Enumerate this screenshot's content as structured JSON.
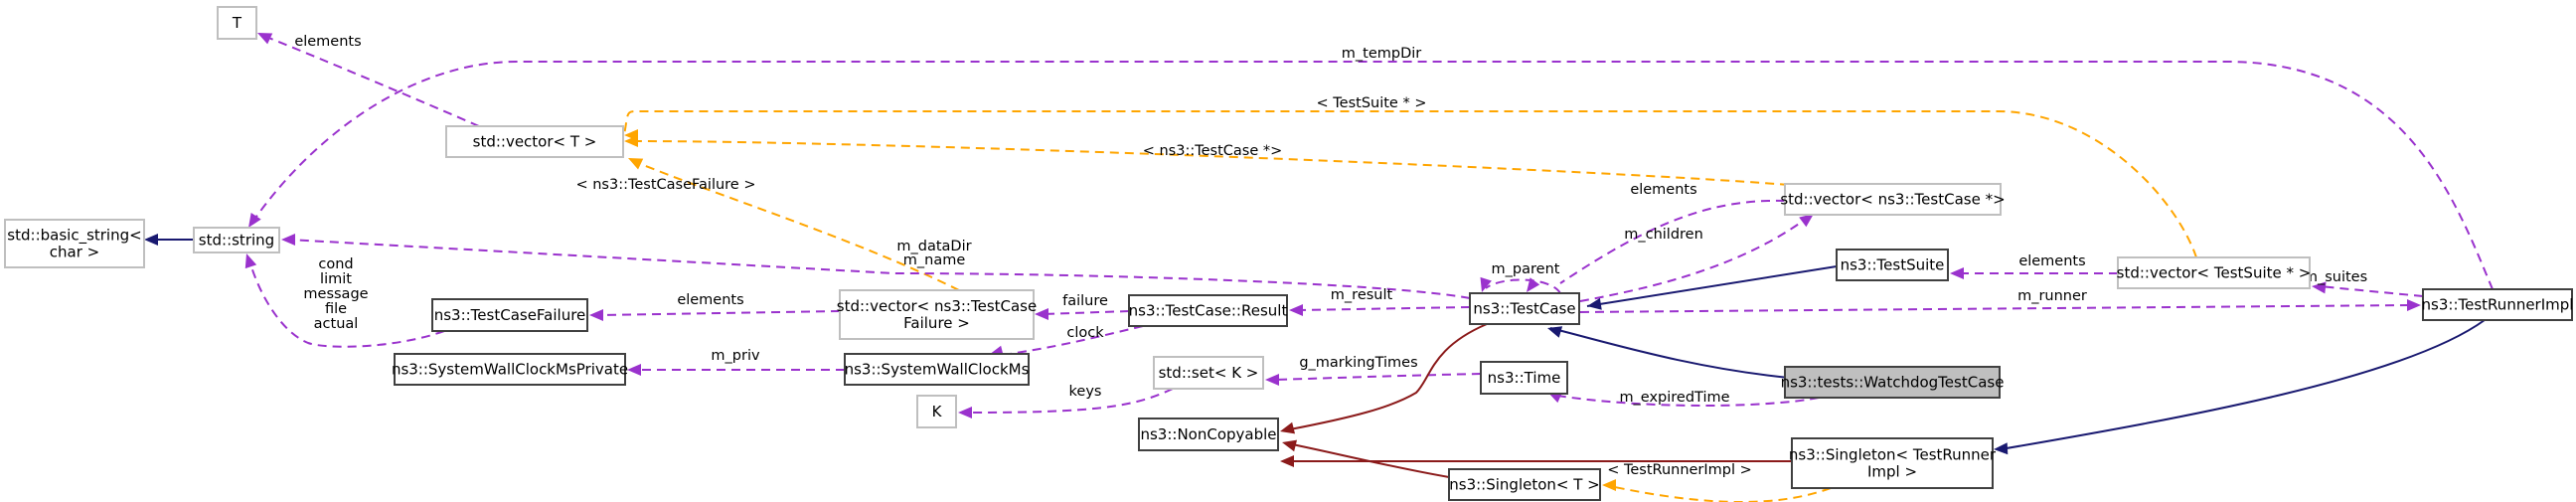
{
  "diagram": {
    "type": "doxygen-collaboration-graph",
    "focus_node": "ns3::tests::WatchdogTestCase",
    "colors": {
      "inheritance": "#191970",
      "usage": "#9a32cd",
      "template": "#ffa500",
      "private_inheritance": "#8b1a1a",
      "focus_fill": "#bfbfbf",
      "documented_border": "#404040",
      "undocumented_border": "#bfbfbf"
    },
    "nodes": [
      {
        "id": "T",
        "lines": [
          "T"
        ],
        "style": "undocumented"
      },
      {
        "id": "vectorT",
        "lines": [
          "std::vector< T >"
        ],
        "style": "undocumented"
      },
      {
        "id": "basic_string",
        "lines": [
          "std::basic_string<",
          "char >"
        ],
        "style": "undocumented"
      },
      {
        "id": "string",
        "lines": [
          "std::string"
        ],
        "style": "undocumented"
      },
      {
        "id": "TestCaseFailure",
        "lines": [
          "ns3::TestCaseFailure"
        ],
        "style": "documented"
      },
      {
        "id": "SWCMsPrivate",
        "lines": [
          "ns3::SystemWallClockMsPrivate"
        ],
        "style": "documented"
      },
      {
        "id": "vectorTCF",
        "lines": [
          "std::vector< ns3::TestCase",
          "Failure >"
        ],
        "style": "undocumented"
      },
      {
        "id": "SWCMs",
        "lines": [
          "ns3::SystemWallClockMs"
        ],
        "style": "documented"
      },
      {
        "id": "K",
        "lines": [
          "K"
        ],
        "style": "undocumented"
      },
      {
        "id": "Result",
        "lines": [
          "ns3::TestCase::Result"
        ],
        "style": "documented"
      },
      {
        "id": "setK",
        "lines": [
          "std::set< K >"
        ],
        "style": "undocumented"
      },
      {
        "id": "NonCopyable",
        "lines": [
          "ns3::NonCopyable"
        ],
        "style": "documented"
      },
      {
        "id": "TestCase",
        "lines": [
          "ns3::TestCase"
        ],
        "style": "documented"
      },
      {
        "id": "Time",
        "lines": [
          "ns3::Time"
        ],
        "style": "documented"
      },
      {
        "id": "SingletonT",
        "lines": [
          "ns3::Singleton< T >"
        ],
        "style": "documented"
      },
      {
        "id": "vectorTC",
        "lines": [
          "std::vector< ns3::TestCase *>"
        ],
        "style": "undocumented"
      },
      {
        "id": "TestSuite",
        "lines": [
          "ns3::TestSuite"
        ],
        "style": "documented"
      },
      {
        "id": "Watchdog",
        "lines": [
          "ns3::tests::WatchdogTestCase"
        ],
        "style": "focus"
      },
      {
        "id": "SingletonTRI",
        "lines": [
          "ns3::Singleton< TestRunner",
          "Impl >"
        ],
        "style": "documented"
      },
      {
        "id": "vectorTS",
        "lines": [
          "std::vector< TestSuite * >"
        ],
        "style": "undocumented"
      },
      {
        "id": "TestRunnerImpl",
        "lines": [
          "ns3::TestRunnerImpl"
        ],
        "style": "documented"
      }
    ],
    "edges": [
      {
        "from": "string",
        "to": "basic_string",
        "kind": "inheritance",
        "label": []
      },
      {
        "from": "vectorT",
        "to": "T",
        "kind": "usage",
        "label": [
          "elements"
        ]
      },
      {
        "from": "TestRunnerImpl",
        "to": "string",
        "kind": "usage",
        "label": [
          "m_tempDir"
        ]
      },
      {
        "from": "vectorTS",
        "to": "vectorT",
        "kind": "template",
        "label": [
          "< TestSuite * >"
        ]
      },
      {
        "from": "vectorTC",
        "to": "vectorT",
        "kind": "template",
        "label": [
          "< ns3::TestCase *>"
        ]
      },
      {
        "from": "vectorTCF",
        "to": "vectorT",
        "kind": "template",
        "label": [
          "< ns3::TestCaseFailure >"
        ]
      },
      {
        "from": "TestCase",
        "to": "string",
        "kind": "usage",
        "label": [
          "m_dataDir",
          "m_name"
        ]
      },
      {
        "from": "TestCaseFailure",
        "to": "string",
        "kind": "usage",
        "label": [
          "cond",
          "limit",
          "message",
          "file",
          "actual"
        ]
      },
      {
        "from": "vectorTCF",
        "to": "TestCaseFailure",
        "kind": "usage",
        "label": [
          "elements"
        ]
      },
      {
        "from": "SWCMs",
        "to": "SWCMsPrivate",
        "kind": "usage",
        "label": [
          "m_priv"
        ]
      },
      {
        "from": "Result",
        "to": "vectorTCF",
        "kind": "usage",
        "label": [
          "failure"
        ]
      },
      {
        "from": "Result",
        "to": "SWCMs",
        "kind": "usage",
        "label": [
          "clock"
        ]
      },
      {
        "from": "setK",
        "to": "K",
        "kind": "usage",
        "label": [
          "keys"
        ]
      },
      {
        "from": "TestCase",
        "to": "Result",
        "kind": "usage",
        "label": [
          "m_result"
        ]
      },
      {
        "from": "Time",
        "to": "setK",
        "kind": "usage",
        "label": [
          "g_markingTimes"
        ]
      },
      {
        "from": "TestCase",
        "to": "NonCopyable",
        "kind": "private_inheritance",
        "label": []
      },
      {
        "from": "SingletonTRI",
        "to": "NonCopyable",
        "kind": "private_inheritance",
        "label": []
      },
      {
        "from": "SingletonT",
        "to": "NonCopyable",
        "kind": "private_inheritance",
        "label": []
      },
      {
        "from": "TestCase",
        "to": "TestCase",
        "kind": "usage",
        "label": [
          "m_parent"
        ]
      },
      {
        "from": "vectorTC",
        "to": "TestCase",
        "kind": "usage",
        "label": [
          "elements"
        ]
      },
      {
        "from": "TestCase",
        "to": "vectorTC",
        "kind": "usage",
        "label": [
          "m_children"
        ]
      },
      {
        "from": "TestSuite",
        "to": "TestCase",
        "kind": "inheritance",
        "label": []
      },
      {
        "from": "Watchdog",
        "to": "TestCase",
        "kind": "inheritance",
        "label": []
      },
      {
        "from": "Watchdog",
        "to": "Time",
        "kind": "usage",
        "label": [
          "m_expiredTime"
        ]
      },
      {
        "from": "SingletonTRI",
        "to": "SingletonT",
        "kind": "template",
        "label": [
          "< TestRunnerImpl >"
        ]
      },
      {
        "from": "vectorTS",
        "to": "TestSuite",
        "kind": "usage",
        "label": [
          "elements"
        ]
      },
      {
        "from": "TestCase",
        "to": "TestRunnerImpl",
        "kind": "usage",
        "label": [
          "m_runner"
        ]
      },
      {
        "from": "TestRunnerImpl",
        "to": "vectorTS",
        "kind": "usage",
        "label": [
          "m_suites"
        ]
      },
      {
        "from": "TestRunnerImpl",
        "to": "SingletonTRI",
        "kind": "inheritance",
        "label": []
      }
    ]
  }
}
